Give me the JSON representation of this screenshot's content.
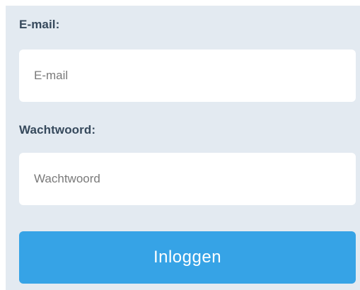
{
  "form": {
    "email_label": "E-mail:",
    "email_placeholder": "E-mail",
    "email_value": "",
    "password_label": "Wachtwoord:",
    "password_placeholder": "Wachtwoord",
    "password_value": "",
    "submit_label": "Inloggen"
  },
  "colors": {
    "panel_background": "#e3eaf1",
    "label_text": "#36495c",
    "button_background": "#36a3e6",
    "button_text": "#ffffff"
  }
}
